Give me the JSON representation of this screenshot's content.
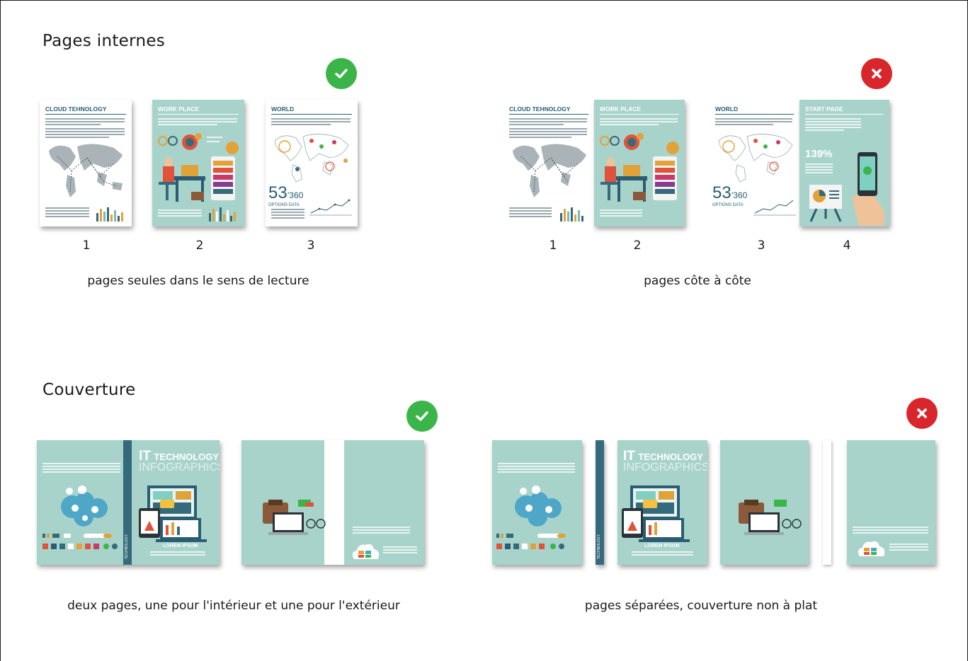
{
  "sections": {
    "inner": {
      "heading": "Pages internes"
    },
    "cover": {
      "heading": "Couverture"
    }
  },
  "inner_ok": {
    "status": "check-icon",
    "caption": "pages seules dans le sens de lecture",
    "numbers": [
      "1",
      "2",
      "3"
    ]
  },
  "inner_bad": {
    "status": "cross-icon",
    "caption": "pages côte à côte",
    "numbers": [
      "1",
      "2",
      "3",
      "4"
    ]
  },
  "cover_ok": {
    "status": "check-icon",
    "caption": "deux pages, une pour l'intérieur et une pour l'extérieur"
  },
  "cover_bad": {
    "status": "cross-icon",
    "caption": "pages séparées, couverture non à plat"
  },
  "thumbnails": {
    "cloud_title": "CLOUD TEHNOLOGY",
    "work_title": "WORK PLACE",
    "world_title": "WORLD",
    "start_title": "START PAGE",
    "stat_value": "53",
    "stat_sub": "'360",
    "stat_label": "OPTIONS DATA",
    "percent": "139%",
    "cover_it": "IT",
    "cover_tech": "TECHNOLOGY",
    "cover_info": "INFOGRAPHICS",
    "cover_lorem": "LOREM IPSUM",
    "spine_label": "TECHNOLOGY"
  },
  "colors": {
    "teal": "#a8d3cb",
    "spine": "#356a7c",
    "ok": "#3bb54a",
    "ko": "#d9262c"
  }
}
